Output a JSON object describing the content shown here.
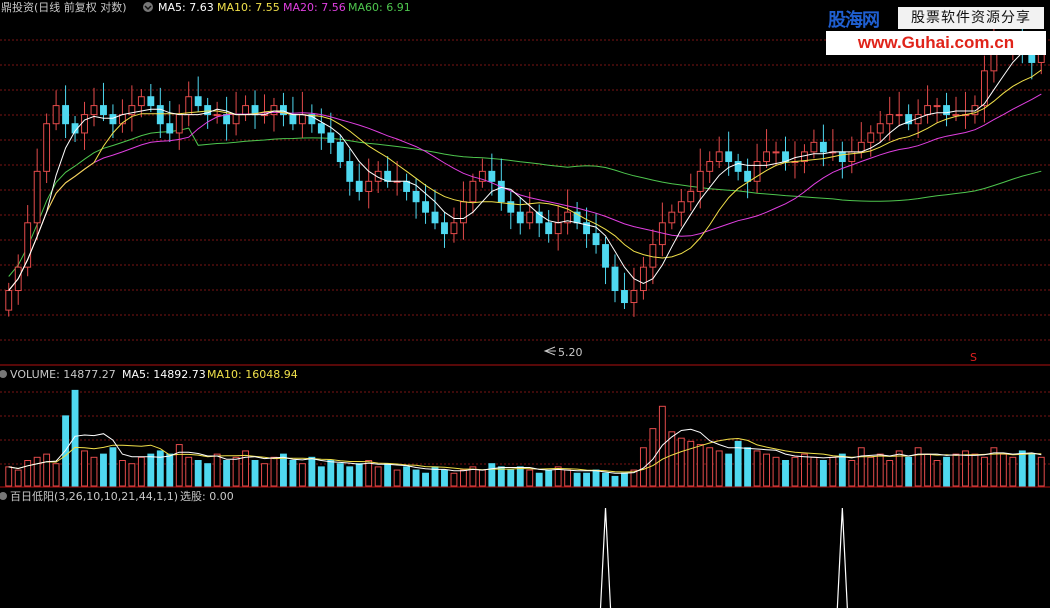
{
  "colors": {
    "up": "#e34b4b",
    "down": "#4fd8f0",
    "ma5": "#ffffff",
    "ma10": "#f0e04a",
    "ma20": "#e03fe0",
    "ma60": "#4ec64e",
    "grid": "#7a1515",
    "divider": "#b01010",
    "text": "#c8c8c8"
  },
  "main_header": {
    "title": "鼎投资(日线 前复权 对数)",
    "ma5": "MA5: 7.63",
    "ma10": "MA10: 7.55",
    "ma20": "MA20: 7.56",
    "ma60": "MA60: 6.91"
  },
  "low_marker": "5.20",
  "signal_mark": "S",
  "volume_header": {
    "label": "VOLUME: 14877.27",
    "ma5": "MA5: 14892.73",
    "ma10": "MA10: 16048.94"
  },
  "indicator_header": {
    "label": "百日低阳(3,26,10,10,21,44,1,1)",
    "value": "选股: 0.00"
  },
  "logo": {
    "brand": "股海网",
    "tagline": "股票软件资源分享",
    "url": "www.Guhai.com.cn"
  },
  "chart_data": [
    {
      "type": "candlestick",
      "title": "鼎投资(日线 前复权 对数)",
      "log_scale": true,
      "ylim": [
        5.0,
        8.2
      ],
      "series": [
        {
          "name": "MA5",
          "last": 7.63
        },
        {
          "name": "MA10",
          "last": 7.55
        },
        {
          "name": "MA20",
          "last": 7.56
        },
        {
          "name": "MA60",
          "last": 6.91
        }
      ],
      "close_approx": [
        5.4,
        5.6,
        6.0,
        6.5,
        7.0,
        7.2,
        7.0,
        6.9,
        7.1,
        7.2,
        7.1,
        7.0,
        7.1,
        7.2,
        7.3,
        7.2,
        7.0,
        6.9,
        7.1,
        7.3,
        7.2,
        7.1,
        7.1,
        7.0,
        7.1,
        7.2,
        7.1,
        7.1,
        7.2,
        7.1,
        7.0,
        7.1,
        7.0,
        6.9,
        6.8,
        6.6,
        6.4,
        6.3,
        6.4,
        6.5,
        6.4,
        6.4,
        6.3,
        6.2,
        6.1,
        6.0,
        5.9,
        6.0,
        6.2,
        6.4,
        6.5,
        6.4,
        6.2,
        6.1,
        6.0,
        6.1,
        6.0,
        5.9,
        6.0,
        6.1,
        6.0,
        5.9,
        5.8,
        5.6,
        5.4,
        5.3,
        5.4,
        5.6,
        5.8,
        6.0,
        6.1,
        6.2,
        6.3,
        6.5,
        6.6,
        6.7,
        6.6,
        6.5,
        6.4,
        6.6,
        6.7,
        6.7,
        6.6,
        6.6,
        6.7,
        6.8,
        6.7,
        6.7,
        6.6,
        6.7,
        6.8,
        6.9,
        7.0,
        7.1,
        7.1,
        7.0,
        7.1,
        7.2,
        7.2,
        7.1,
        7.1,
        7.1,
        7.2,
        7.6,
        7.9,
        7.9,
        7.9,
        7.8,
        7.7,
        7.9
      ],
      "min_marker": {
        "value": 5.2
      }
    },
    {
      "type": "bar",
      "title": "VOLUME",
      "series": [
        {
          "name": "VOLUME",
          "last": 14877.27
        },
        {
          "name": "MA5",
          "last": 14892.73
        },
        {
          "name": "MA10",
          "last": 16048.94
        }
      ],
      "values_approx": [
        6,
        5,
        8,
        9,
        10,
        7,
        22,
        30,
        11,
        9,
        10,
        12,
        8,
        7,
        9,
        10,
        11,
        10,
        13,
        9,
        8,
        7,
        10,
        8,
        9,
        11,
        8,
        7,
        9,
        10,
        8,
        7,
        9,
        6,
        8,
        7,
        6,
        7,
        8,
        6,
        7,
        5,
        6,
        5,
        4,
        6,
        5,
        4,
        5,
        6,
        5,
        7,
        6,
        5,
        6,
        5,
        4,
        5,
        6,
        5,
        4,
        4,
        5,
        4,
        3,
        4,
        5,
        12,
        18,
        25,
        17,
        15,
        14,
        13,
        12,
        11,
        10,
        14,
        12,
        11,
        10,
        9,
        8,
        9,
        10,
        9,
        8,
        9,
        10,
        8,
        12,
        9,
        10,
        8,
        11,
        9,
        12,
        10,
        8,
        9,
        10,
        11,
        10,
        9,
        12,
        10,
        9,
        11,
        10,
        9
      ],
      "ylim": [
        0,
        32
      ]
    },
    {
      "type": "line",
      "title": "百日低阳(3,26,10,10,21,44,1,1)",
      "series": [
        {
          "name": "选股",
          "last": 0.0
        }
      ],
      "signal_days": [
        63,
        88
      ],
      "ylim": [
        0,
        1
      ]
    }
  ]
}
